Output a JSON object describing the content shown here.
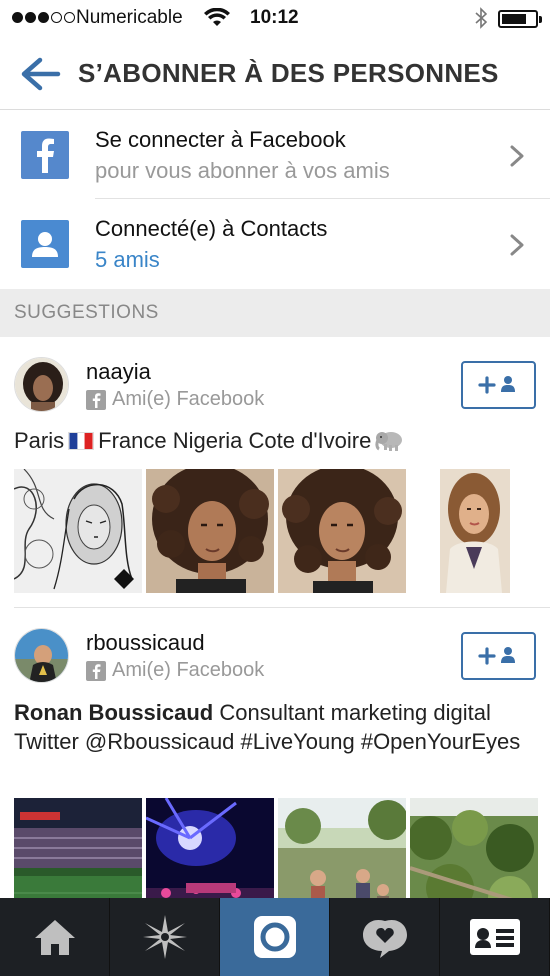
{
  "status_bar": {
    "carrier": "Numericable",
    "time": "10:12"
  },
  "header": {
    "title": "S’ABONNER À DES PERSONNES",
    "back_icon": "arrow-left-icon"
  },
  "connect": [
    {
      "title": "Se connecter à Facebook",
      "subtitle": "pour vous abonner à vos amis",
      "icon": "facebook-icon"
    },
    {
      "title": "Connecté(e) à Contacts",
      "subtitle": "5 amis",
      "icon": "contacts-icon"
    }
  ],
  "section": {
    "label": "SUGGESTIONS"
  },
  "suggestions": [
    {
      "username": "naayia",
      "source": "Ami(e) Facebook",
      "bio_before_flag": "Paris",
      "bio_after_flag": "France Nigeria Cote d'Ivoire",
      "follow_icon": "add-user-icon"
    },
    {
      "username": "rboussicaud",
      "source": "Ami(e) Facebook",
      "bio_name": "Ronan Boussicaud",
      "bio_text": " Consultant marketing digital Twitter @Rboussicaud #LiveYoung #OpenYourEyes",
      "follow_icon": "add-user-icon"
    }
  ],
  "tabs": [
    {
      "name": "home-icon"
    },
    {
      "name": "explore-star-icon"
    },
    {
      "name": "camera-icon",
      "active": true
    },
    {
      "name": "activity-heart-icon"
    },
    {
      "name": "profile-card-icon"
    }
  ],
  "colors": {
    "accent": "#3a85c8",
    "follow_border": "#3a6fa8",
    "tab_bar": "#1d2024",
    "tab_active": "#3a6a9a"
  }
}
